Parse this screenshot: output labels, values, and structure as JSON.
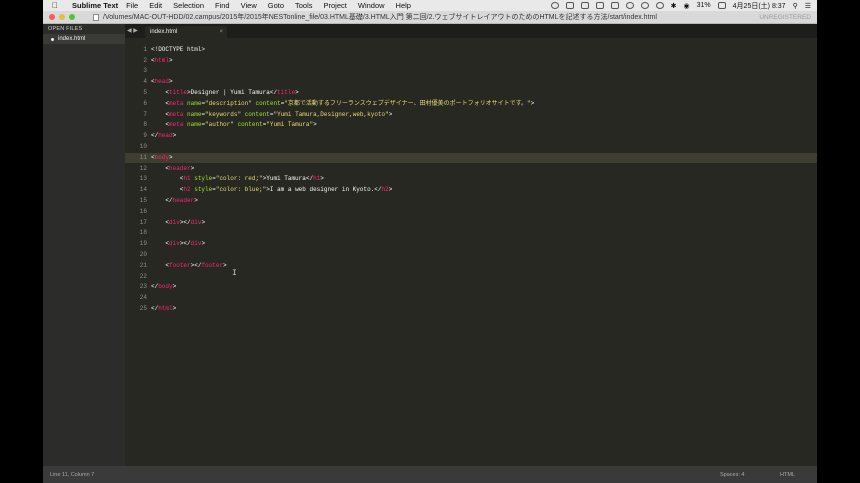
{
  "menubar": {
    "app_name": "Sublime Text",
    "items": [
      "File",
      "Edit",
      "Selection",
      "Find",
      "View",
      "Goto",
      "Tools",
      "Project",
      "Window",
      "Help"
    ],
    "battery": "31%",
    "date_time": "4月25日(土)  8:37"
  },
  "window": {
    "title_path": "/Volumes/MAC-OUT-HDD/02.campus/2015年/2015年NESTonline_file/03.HTML基礎/3.HTML入門 第二回/2.ウェブサイトレイアウトのためのHTMLを記述する方法/start/index.html",
    "registration": "UNREGISTERED"
  },
  "sidebar": {
    "header": "OPEN FILES",
    "files": [
      "index.html"
    ]
  },
  "tabs": [
    {
      "label": "index.html",
      "close": "×"
    }
  ],
  "editor": {
    "highlight_line": 11,
    "line_numbers": [
      "1",
      "2",
      "3",
      "4",
      "5",
      "6",
      "7",
      "8",
      "9",
      "10",
      "11",
      "12",
      "13",
      "14",
      "15",
      "16",
      "17",
      "18",
      "19",
      "20",
      "21",
      "22",
      "23",
      "24",
      "25"
    ]
  },
  "statusbar": {
    "position": "Line 11, Column 7",
    "indent": "Spaces: 4",
    "syntax": "HTML"
  },
  "colors": {
    "background": "#272822",
    "tag": "#f92672",
    "attribute": "#a6e22e",
    "string": "#e6db74",
    "text": "#f8f8f2"
  }
}
